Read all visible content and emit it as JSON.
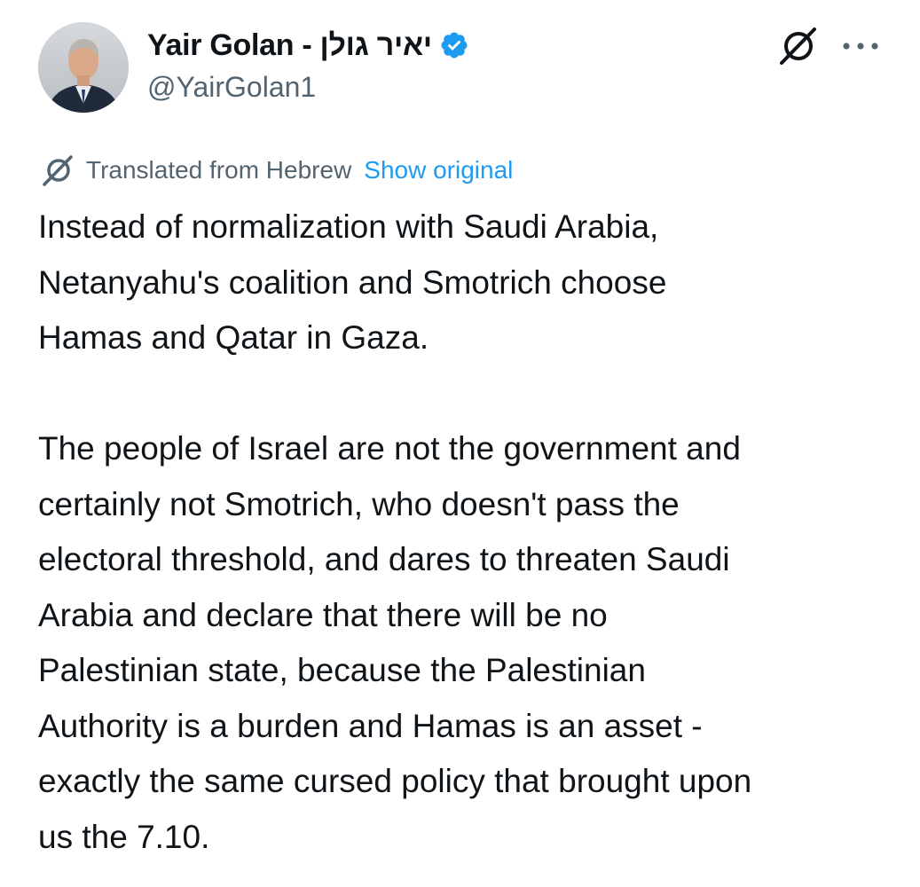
{
  "author": {
    "display_name": "Yair Golan - יאיר גולן",
    "handle": "@YairGolan1",
    "verified": true,
    "avatar_icon": "profile-photo",
    "verified_color": "#1d9bf0"
  },
  "header_actions": {
    "grok_icon": "grok-icon",
    "more_icon": "more-icon"
  },
  "translation": {
    "icon": "translate-icon",
    "label": "Translated from Hebrew",
    "show_original": "Show original"
  },
  "tweet": {
    "paragraphs": [
      "Instead of normalization with Saudi Arabia,\nNetanyahu's coalition and Smotrich choose\nHamas and Qatar in Gaza.",
      "The people of Israel are not the government and\ncertainly not Smotrich, who doesn't pass the\nelectoral threshold, and dares to threaten Saudi\nArabia and declare that there will be no\nPalestinian state, because the Palestinian\nAuthority is a burden and Hamas is an asset -\nexactly the same cursed policy that brought upon\nus the 7.10."
    ]
  },
  "colors": {
    "text": "#0f1419",
    "secondary": "#536471",
    "link": "#1d9bf0",
    "background": "#ffffff"
  }
}
